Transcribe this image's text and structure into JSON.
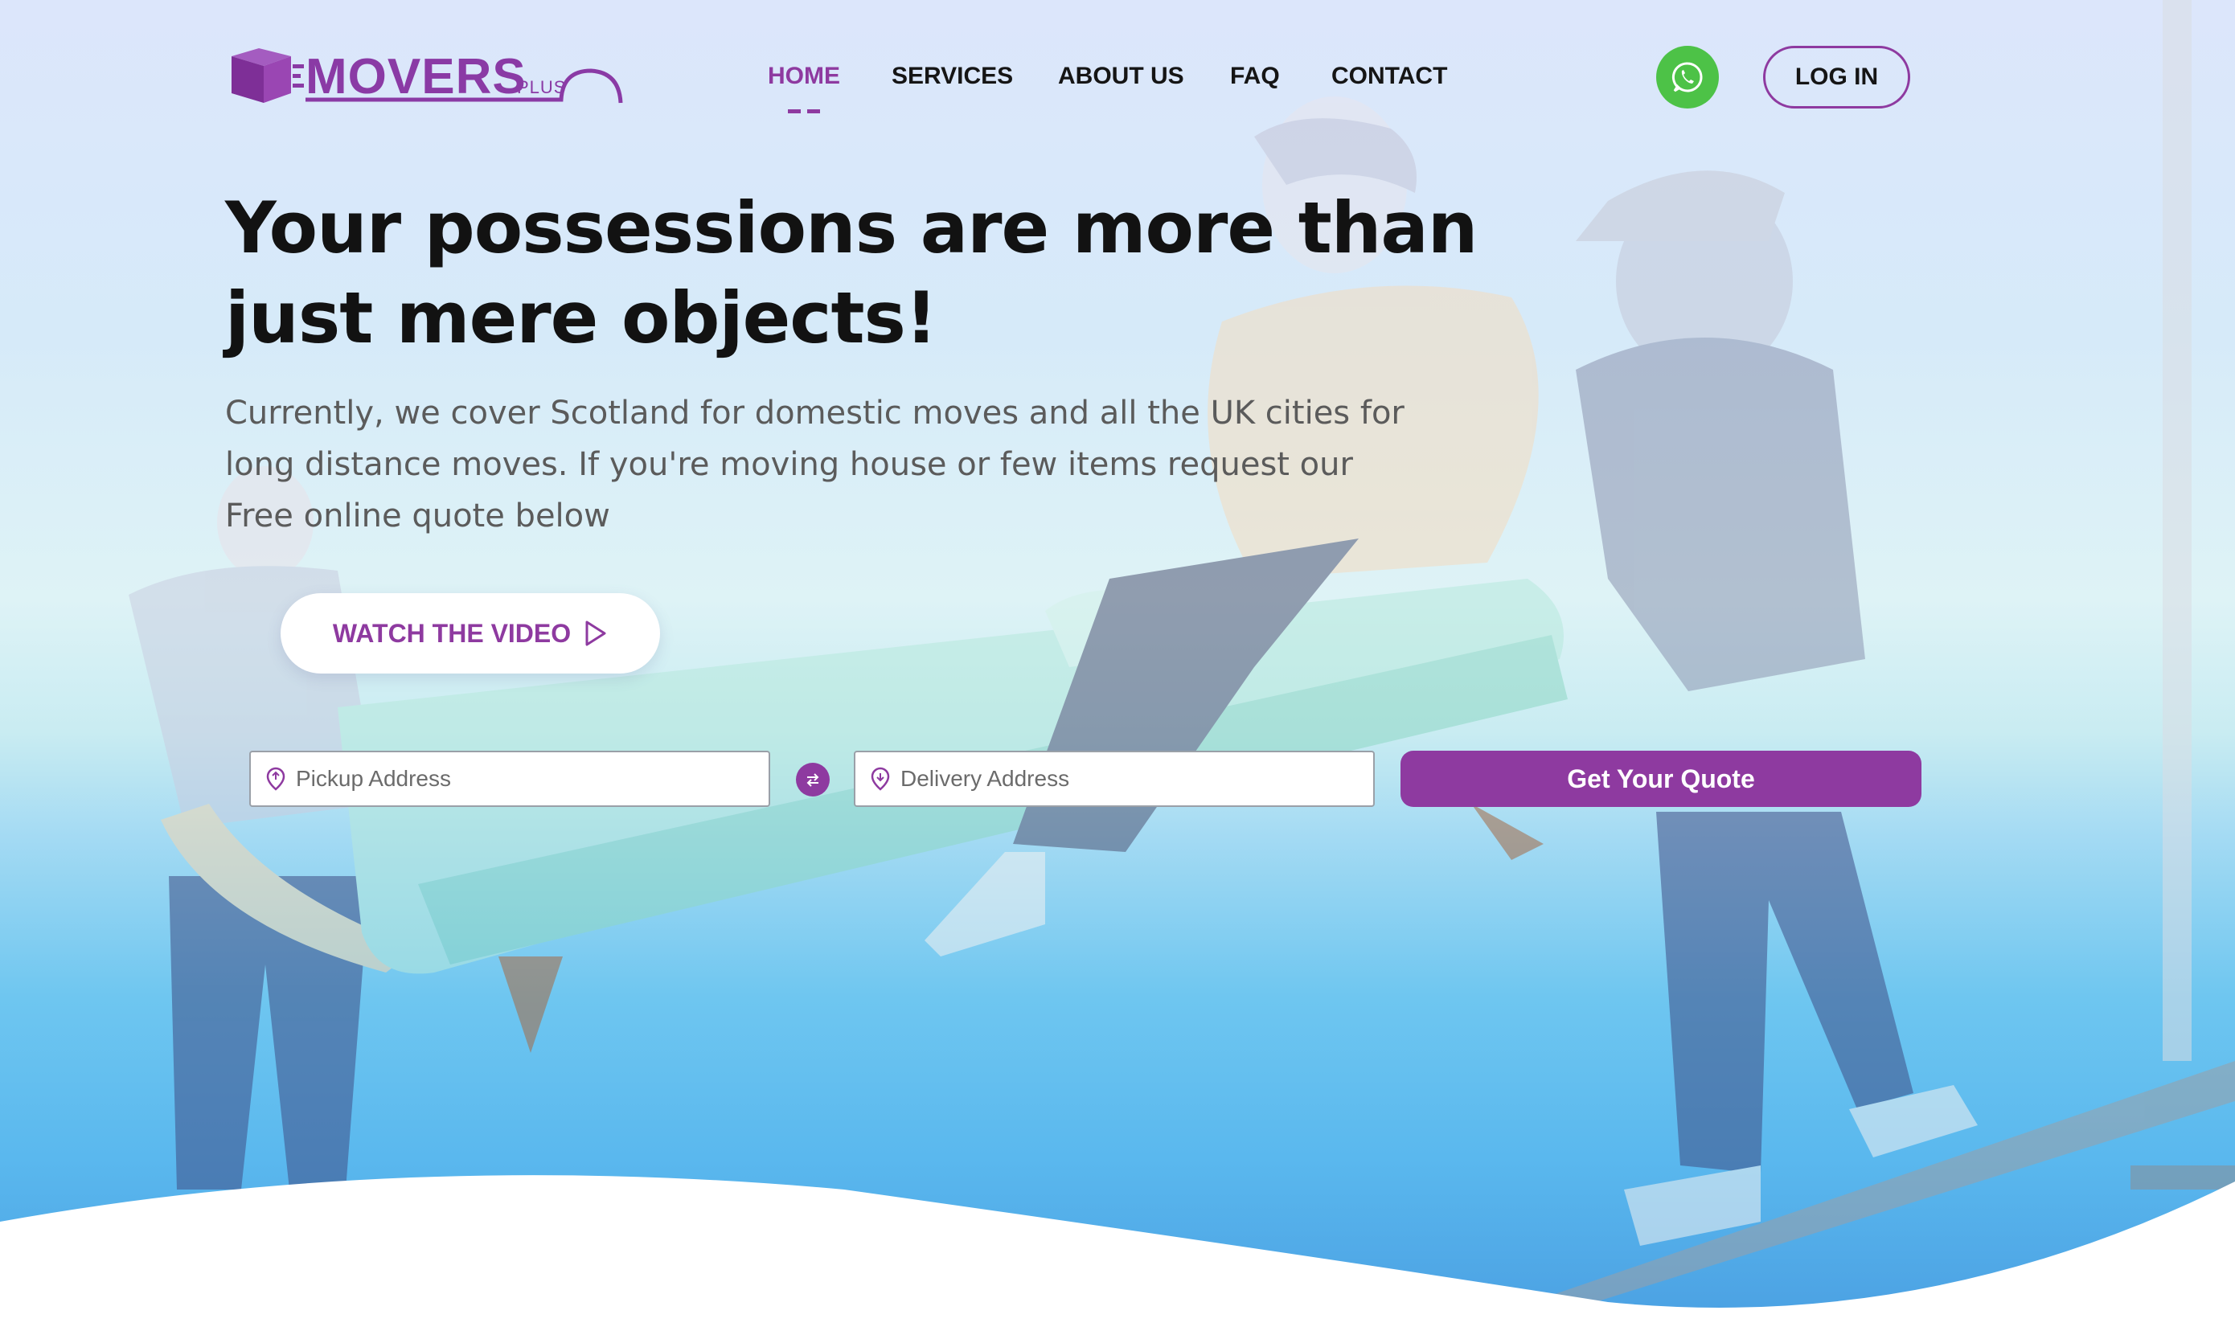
{
  "brand": {
    "logo_text": "MOVERS",
    "logo_sub": "PLUS",
    "primary_color": "#8e3aa0",
    "whatsapp_color": "#4dc247"
  },
  "nav": {
    "items": [
      {
        "label": "HOME",
        "active": true
      },
      {
        "label": "SERVICES",
        "active": false
      },
      {
        "label": "ABOUT US",
        "active": false
      },
      {
        "label": "FAQ",
        "active": false
      },
      {
        "label": "CONTACT",
        "active": false
      }
    ],
    "whatsapp_icon": "whatsapp-icon",
    "login_label": "LOG IN"
  },
  "hero": {
    "headline_line1": "Your possessions are more than",
    "headline_line2": "just mere objects!",
    "subtext_line1": "Currently, we cover Scotland for domestic moves and all the UK cities for",
    "subtext_line2": "long distance moves. If you're moving house or few items request our",
    "subtext_line3": "Free online quote below",
    "watch_video_label": "WATCH THE VIDEO",
    "watch_video_icon": "play-icon"
  },
  "quote_form": {
    "pickup_placeholder": "Pickup Address",
    "delivery_placeholder": "Delivery Address",
    "pin_icon": "location-pin-icon",
    "swap_icon": "swap-icon",
    "submit_label": "Get Your Quote"
  }
}
